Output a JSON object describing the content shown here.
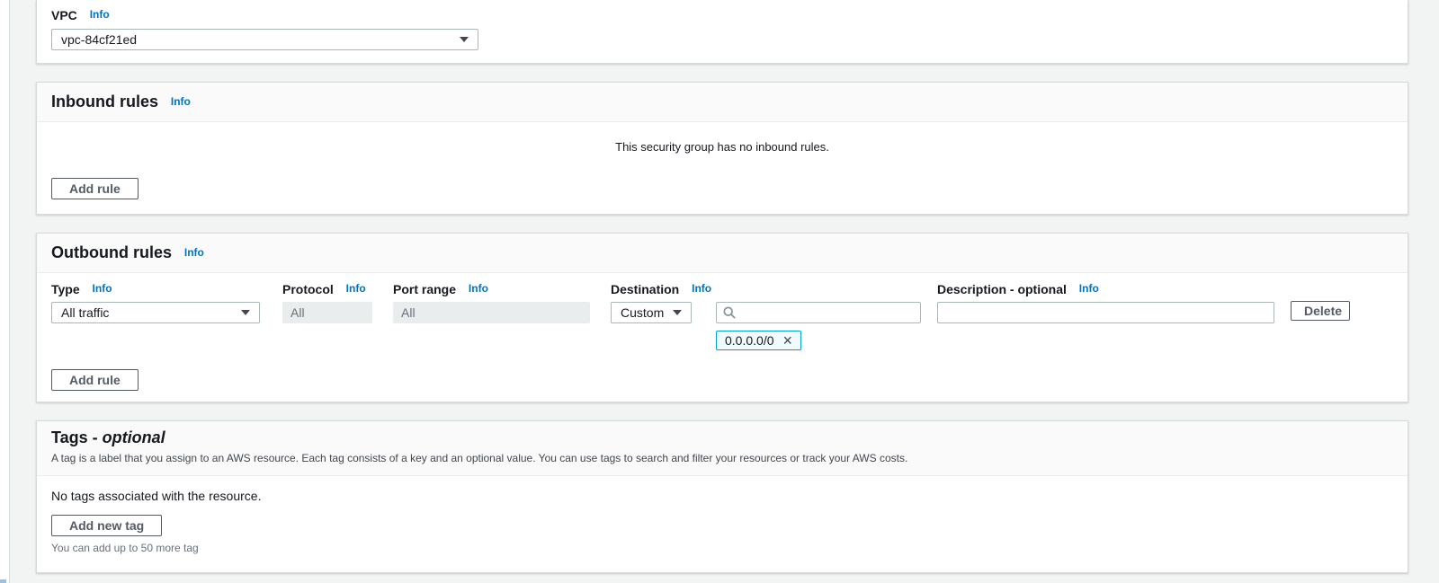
{
  "labels": {
    "info": "Info"
  },
  "icons": {
    "select_caret": "caret-down-filled",
    "search": "magnifier",
    "remove_token_glyph": "×"
  },
  "colors": {
    "page_bg": "#f2f3f3",
    "panel_border": "#d5dbdb",
    "panel_header_bg": "#fafafa",
    "link_blue": "#0073bb",
    "button_border": "#545b64",
    "disabled_input_bg": "#eaeded",
    "token_border": "#00a1c9",
    "token_bg": "#f1faff"
  },
  "vpc": {
    "label": "VPC",
    "selected_value": "vpc-84cf21ed"
  },
  "inbound": {
    "title": "Inbound rules",
    "empty_message": "This security group has no inbound rules.",
    "add_rule": "Add rule"
  },
  "outbound": {
    "title": "Outbound rules",
    "columns": {
      "type": "Type",
      "protocol": "Protocol",
      "port_range": "Port range",
      "destination": "Destination",
      "description": "Description - optional"
    },
    "rule": {
      "type": "All traffic",
      "protocol": "All",
      "port_range": "All",
      "destination_mode": "Custom",
      "destination_search_value": "",
      "destination_token": "0.0.0.0/0",
      "description_value": "",
      "delete": "Delete"
    },
    "add_rule": "Add rule"
  },
  "tags": {
    "title_prefix": "Tags - ",
    "title_optional": "optional",
    "description": "A tag is a label that you assign to an AWS resource. Each tag consists of a key and an optional value. You can use tags to search and filter your resources or track your AWS costs.",
    "empty_message": "No tags associated with the resource.",
    "add_button": "Add new tag",
    "limit_note": "You can add up to 50 more tag"
  }
}
